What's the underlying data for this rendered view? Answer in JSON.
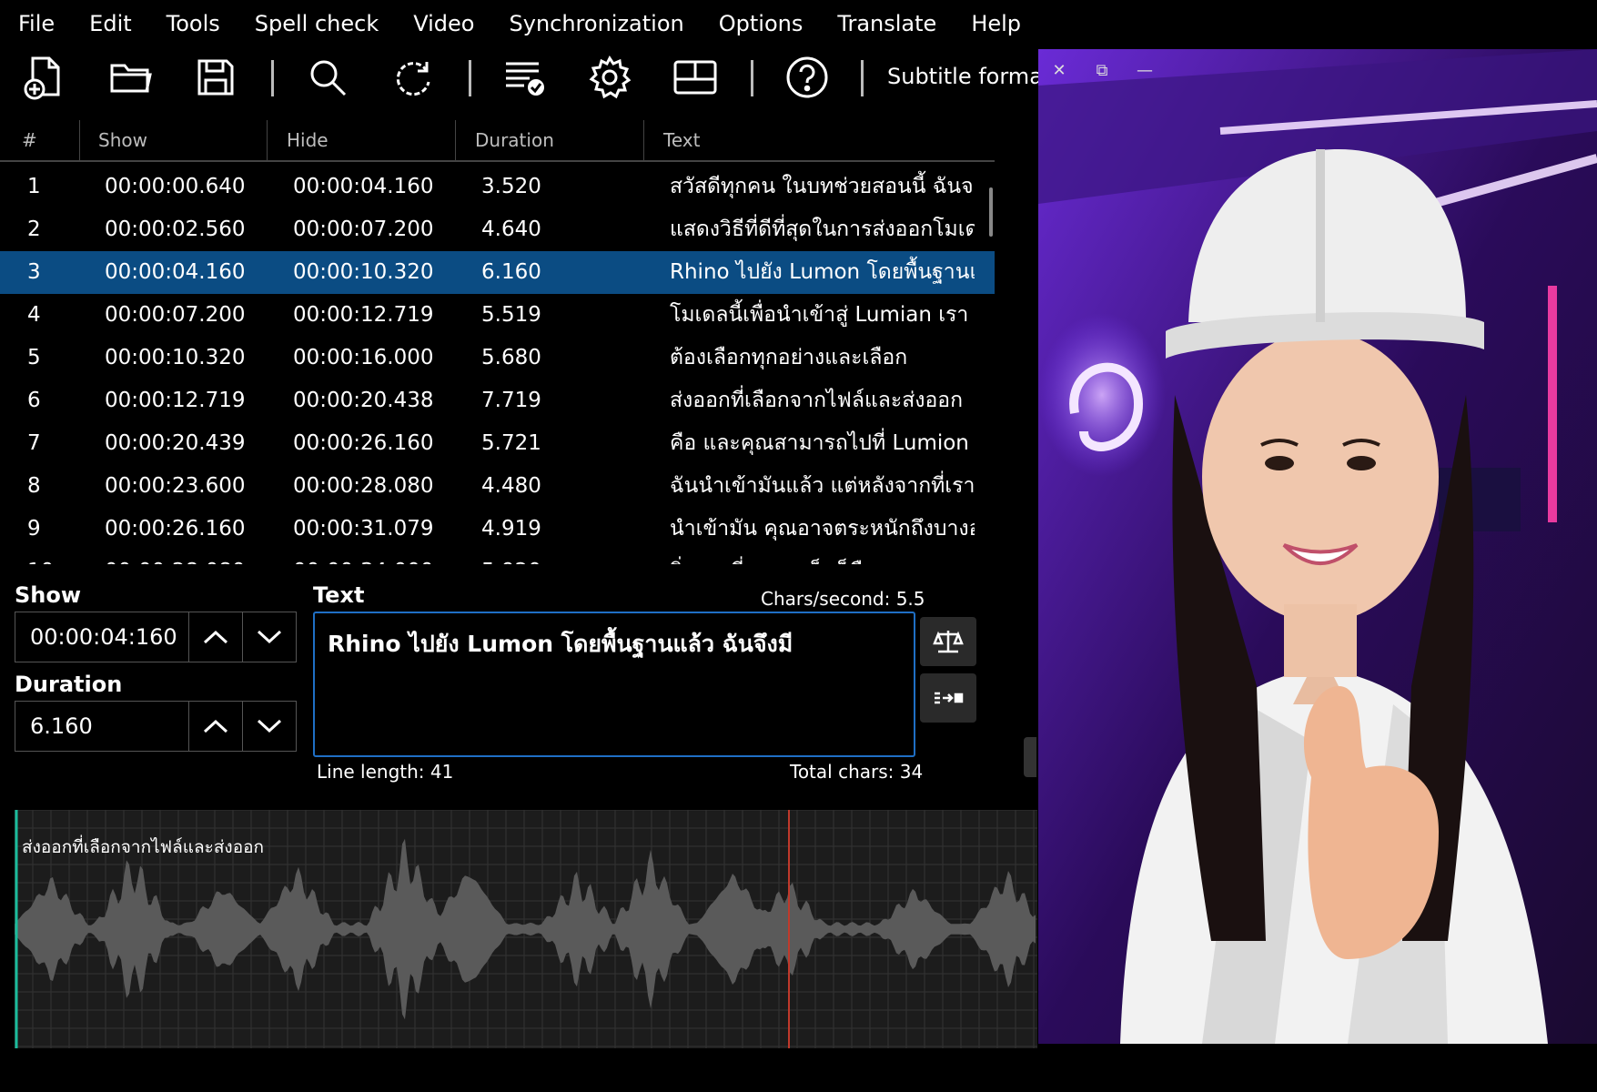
{
  "menu": [
    "File",
    "Edit",
    "Tools",
    "Spell check",
    "Video",
    "Synchronization",
    "Options",
    "Translate",
    "Help"
  ],
  "toolbar": {
    "icons": [
      "new-file-icon",
      "open-folder-icon",
      "save-icon",
      "search-icon",
      "refresh-icon",
      "spell-check-list-icon",
      "gear-icon",
      "layout-icon",
      "help-icon"
    ],
    "subtitle_format_label": "Subtitle format"
  },
  "grid": {
    "columns": [
      "#",
      "Show",
      "Hide",
      "Duration",
      "Text"
    ],
    "selected_row": 3,
    "rows": [
      {
        "num": "1",
        "show": "00:00:00.640",
        "hide": "00:00:04.160",
        "duration": "3.520",
        "text": "สวัสดีทุกคน ในบทช่วยสอนนี้ ฉันจะ"
      },
      {
        "num": "2",
        "show": "00:00:02.560",
        "hide": "00:00:07.200",
        "duration": "4.640",
        "text": "แสดงวิธีที่ดีที่สุดในการส่งออกโมเดล"
      },
      {
        "num": "3",
        "show": "00:00:04.160",
        "hide": "00:00:10.320",
        "duration": "6.160",
        "text": "Rhino ไปยัง Lumon โดยพื้นฐานแล้"
      },
      {
        "num": "4",
        "show": "00:00:07.200",
        "hide": "00:00:12.719",
        "duration": "5.519",
        "text": "โมเดลนี้เพื่อนำเข้าสู่ Lumian เรา"
      },
      {
        "num": "5",
        "show": "00:00:10.320",
        "hide": "00:00:16.000",
        "duration": "5.680",
        "text": "ต้องเลือกทุกอย่างและเลือก"
      },
      {
        "num": "6",
        "show": "00:00:12.719",
        "hide": "00:00:20.438",
        "duration": "7.719",
        "text": "ส่งออกที่เลือกจากไฟล์และส่งออก"
      },
      {
        "num": "7",
        "show": "00:00:20.439",
        "hide": "00:00:26.160",
        "duration": "5.721",
        "text": "คือ และคุณสามารถไปที่ Lumion แล้"
      },
      {
        "num": "8",
        "show": "00:00:23.600",
        "hide": "00:00:28.080",
        "duration": "4.480",
        "text": "ฉันนำเข้ามันแล้ว แต่หลังจากที่เรา"
      },
      {
        "num": "9",
        "show": "00:00:26.160",
        "hide": "00:00:31.079",
        "duration": "4.919",
        "text": "นำเข้ามัน คุณอาจตระหนักถึงบางอย่า"
      },
      {
        "num": "10",
        "show": "00:00:28.080",
        "hide": "00:00:34.000",
        "duration": "5.920",
        "text": "สิ่งแรกที่คุณจะเห็นก็คือ"
      }
    ]
  },
  "editor": {
    "show_label": "Show",
    "show_value": "00:00:04:160",
    "duration_label": "Duration",
    "duration_value": "6.160",
    "text_label": "Text",
    "chars_per_second": "Chars/second: 5.5",
    "text_value": "Rhino ไปยัง Lumon โดยพื้นฐานแล้ว ฉันจึงมี",
    "line_length": "Line length: 41",
    "total_chars": "Total chars: 34"
  },
  "waveform": {
    "subtitle_text": "ส่งออกที่เลือกจากไฟล์และส่งออก"
  },
  "video_window": {
    "controls": [
      "close-icon",
      "restore-icon",
      "minimize-icon"
    ]
  },
  "colors": {
    "selection": "#0b4c83",
    "text_box_border": "#1f6fc5",
    "playhead": "#c0392b",
    "start_marker": "#1abc9c"
  }
}
